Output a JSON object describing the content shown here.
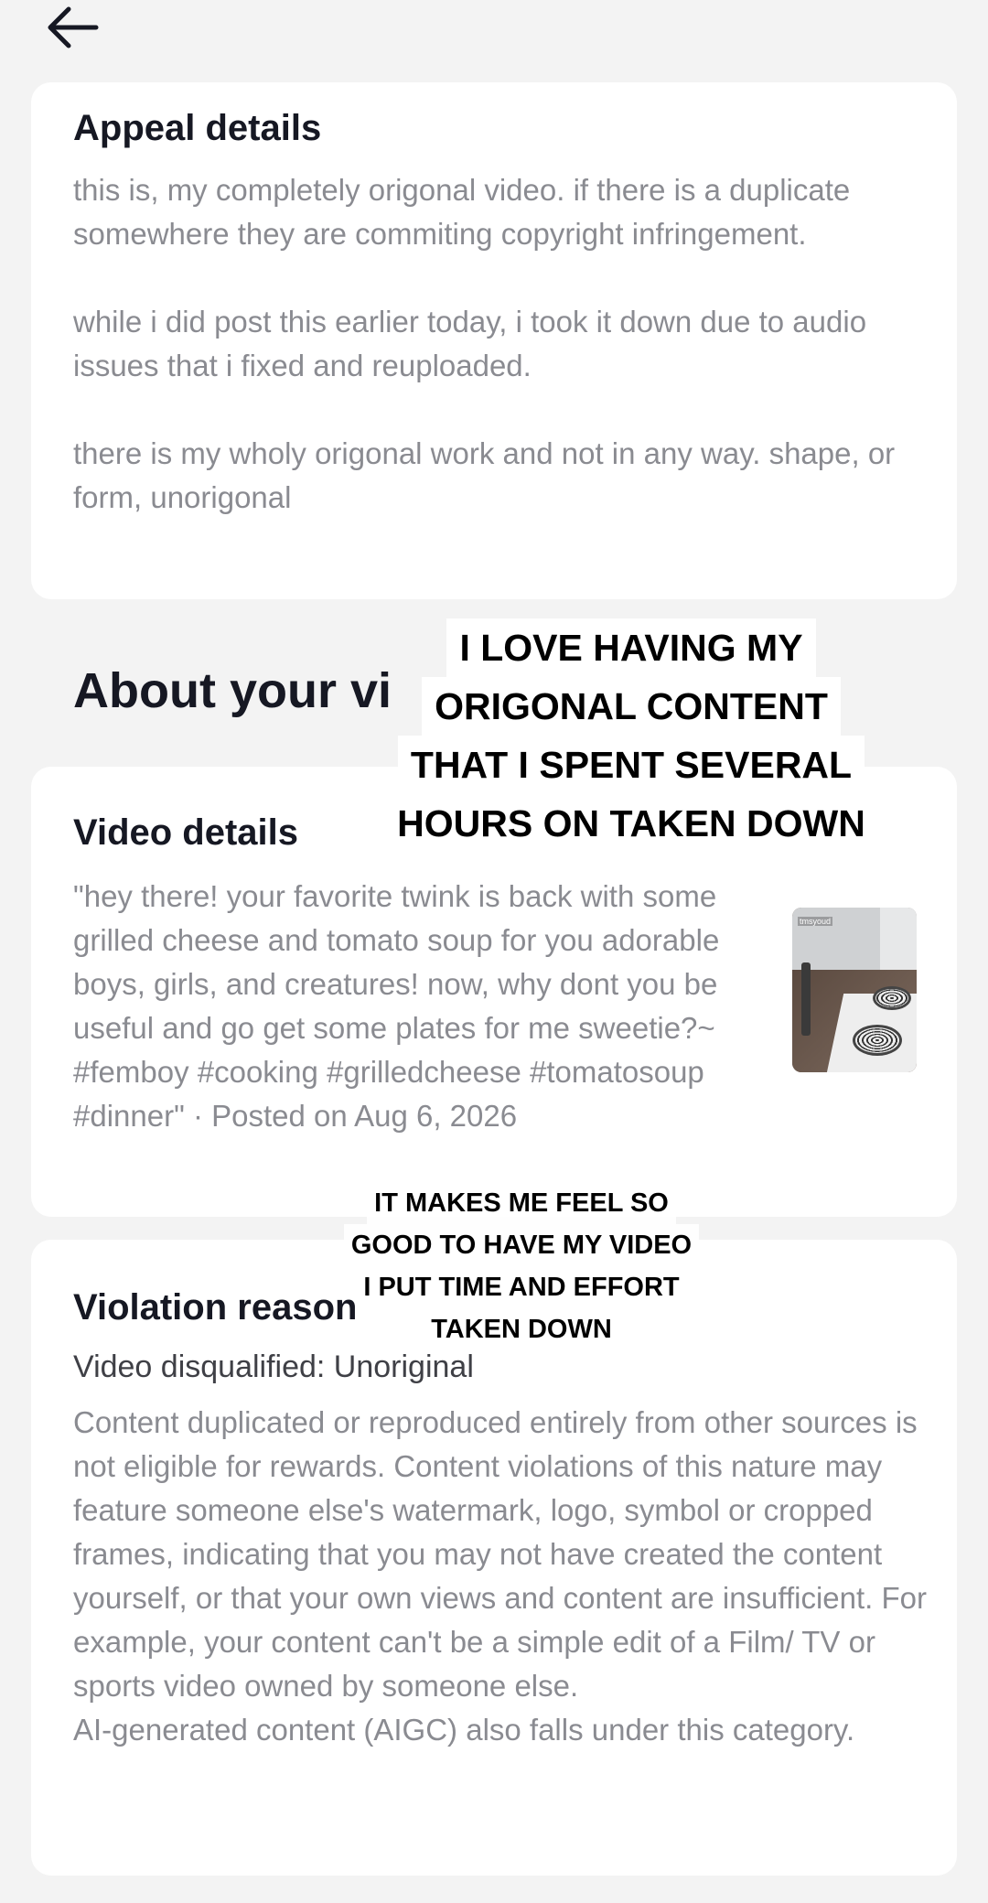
{
  "nav": {
    "back_icon": "arrow-left-icon"
  },
  "appeal": {
    "title": "Appeal details",
    "text": "this is, my completely origonal video. if there is a duplicate somewhere they are commiting copyright infringement.\n\nwhile i did post this earlier today, i took it down due to audio issues that i fixed and reuploaded.\n\nthere is my wholy origonal work and not in any way. shape, or form, unorigonal"
  },
  "about": {
    "title": "About your vi"
  },
  "video": {
    "title": "Video details",
    "description": "\"hey there! your favorite twink is back with some grilled cheese and tomato soup for you adorable boys, girls, and creatures! now, why dont you be useful and go get some plates for me sweetie?~ #femboy #cooking #grilledcheese #tomatosoup #dinner\" · Posted on Aug 6, 2026",
    "thumbnail_label": "tmsyoud"
  },
  "violation": {
    "title": "Violation reason",
    "reason": "Video disqualified: Unoriginal",
    "text": "Content duplicated or reproduced entirely from other sources is not eligible for rewards. Content violations of this nature may feature someone else's watermark, logo, symbol or cropped frames, indicating that you may not have created the content yourself, or that your own views and content are insufficient. For example, your content can't be a simple edit of a Film/ TV or sports video owned by someone else.\nAI-generated content (AIGC) also falls under this category."
  },
  "captions": {
    "top": [
      "I LOVE HAVING MY",
      "ORIGONAL CONTENT",
      "THAT I SPENT SEVERAL",
      "HOURS ON TAKEN DOWN"
    ],
    "middle": [
      "IT MAKES ME FEEL SO",
      "GOOD TO HAVE MY VIDEO",
      "I PUT TIME AND EFFORT",
      "TAKEN DOWN"
    ]
  },
  "colors": {
    "background": "#f3f3f3",
    "card": "#ffffff",
    "title": "#161823",
    "secondary": "#8a8b91"
  }
}
